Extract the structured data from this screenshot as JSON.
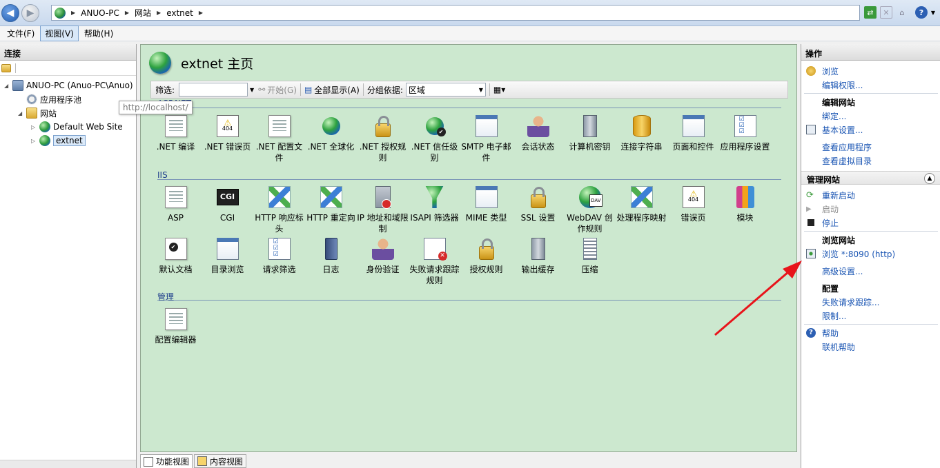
{
  "addressbar": {
    "crumbs": [
      "ANUO-PC",
      "网站",
      "extnet"
    ]
  },
  "menu": [
    "文件(F)",
    "视图(V)",
    "帮助(H)"
  ],
  "connections": {
    "title": "连接",
    "tree": {
      "server": "ANUO-PC (Anuo-PC\\Anuo)",
      "app_pools": "应用程序池",
      "sites": "网站",
      "default_site": "Default Web Site",
      "extnet": "extnet"
    },
    "tooltip": "http://localhost/"
  },
  "center": {
    "title": "extnet 主页",
    "filter_label": "筛选:",
    "filter_value": "",
    "start_label": "开始(G)",
    "show_all_label": "全部显示(A)",
    "group_label": "分组依据:",
    "group_value": "区域",
    "sections": {
      "aspnet": "ASP.NET",
      "iis": "IIS",
      "manage": "管理"
    },
    "aspnet_features": [
      ".NET 编译",
      ".NET 错误页",
      ".NET 配置文件",
      ".NET 全球化",
      ".NET 授权规则",
      ".NET 信任级别",
      "SMTP 电子邮件",
      "会话状态",
      "计算机密钥",
      "连接字符串",
      "页面和控件",
      "应用程序设置"
    ],
    "iis_features_row1": [
      "ASP",
      "CGI",
      "HTTP 响应标头",
      "HTTP 重定向",
      "IP 地址和域限制",
      "ISAPI 筛选器",
      "MIME 类型",
      "SSL 设置",
      "WebDAV 创作规则",
      "处理程序映射",
      "错误页",
      "模块"
    ],
    "iis_features_row2": [
      "默认文档",
      "目录浏览",
      "请求筛选",
      "日志",
      "身份验证",
      "失败请求跟踪规则",
      "授权规则",
      "输出缓存",
      "压缩"
    ],
    "manage_features": [
      "配置编辑器"
    ],
    "tabs": [
      "功能视图",
      "内容视图"
    ]
  },
  "actions": {
    "title": "操作",
    "browse": "浏览",
    "edit_perms": "编辑权限...",
    "edit_site_head": "编辑网站",
    "bindings": "绑定...",
    "basic_settings": "基本设置...",
    "view_apps": "查看应用程序",
    "view_vdirs": "查看虚拟目录",
    "manage_site_head": "管理网站",
    "restart": "重新启动",
    "start": "启动",
    "stop": "停止",
    "browse_site_head": "浏览网站",
    "browse_port": "浏览 *:8090 (http)",
    "advanced": "高级设置...",
    "config_head": "配置",
    "failed_req": "失败请求跟踪...",
    "limits": "限制...",
    "help": "帮助",
    "online_help": "联机帮助"
  }
}
